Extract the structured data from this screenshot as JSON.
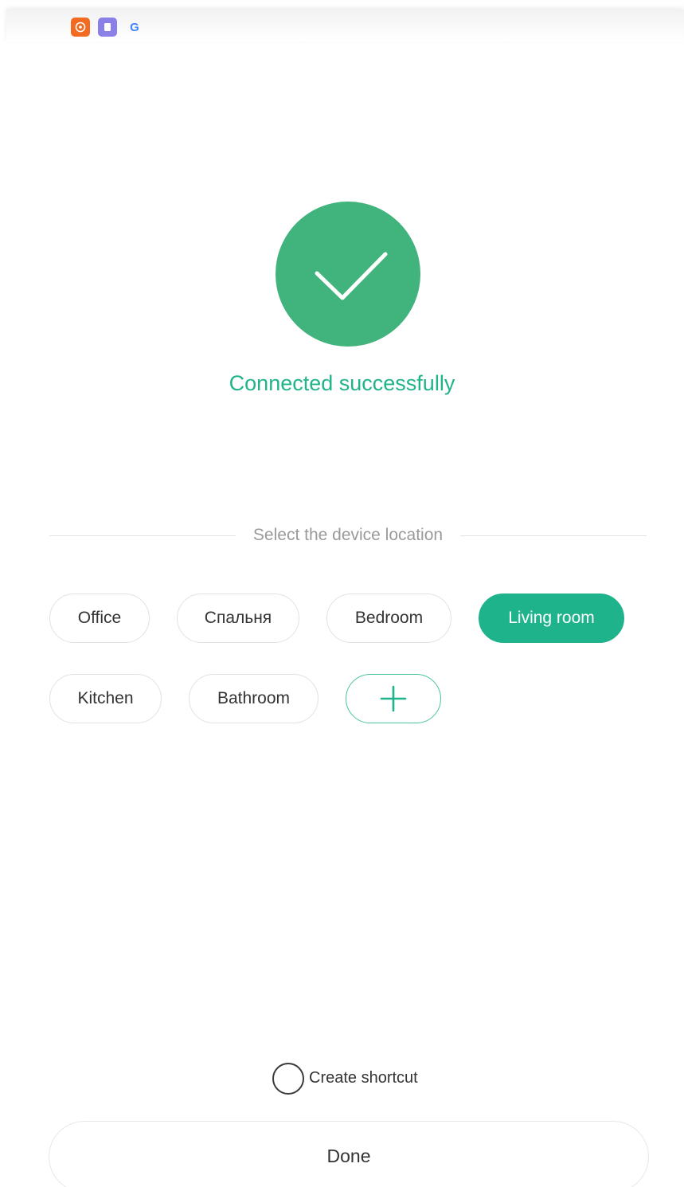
{
  "status_bar": {
    "icons": [
      "orange-app-icon",
      "purple-app-icon",
      "google-icon"
    ],
    "google_glyph": "G"
  },
  "success": {
    "icon": "check-icon",
    "message": "Connected successfully",
    "color": "#41b37c",
    "text_color": "#21b48a"
  },
  "location": {
    "label": "Select the device location",
    "options": [
      {
        "label": "Office",
        "selected": false
      },
      {
        "label": "Спальня",
        "selected": false
      },
      {
        "label": "Bedroom",
        "selected": false
      },
      {
        "label": "Living room",
        "selected": true
      },
      {
        "label": "Kitchen",
        "selected": false
      },
      {
        "label": "Bathroom",
        "selected": false
      }
    ],
    "add_icon": "plus-icon",
    "accent": "#1fb38c"
  },
  "shortcut": {
    "label": "Create shortcut",
    "checked": false
  },
  "footer": {
    "done_label": "Done"
  }
}
